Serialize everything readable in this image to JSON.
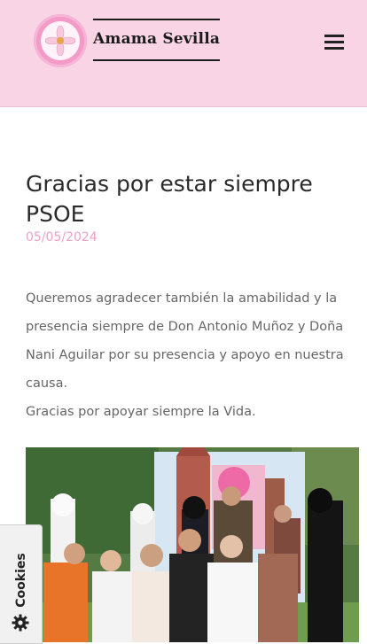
{
  "header": {
    "brand": "Amama Sevilla",
    "logo_icon": "amama-sevilla-logo",
    "menu_icon": "hamburger-menu-icon"
  },
  "post": {
    "title": "Gracias por estar siempre PSOE",
    "date": "05/05/2024",
    "paragraphs": [
      "Queremos agradecer también la amabilidad y la presencia siempre de Don Antonio Muñoz y Doña Nani Aguilar por su presencia y apoyo en nuestra causa.",
      "Gracias por apoyar siempre la Vida."
    ]
  },
  "cookies": {
    "label": "Cookies",
    "icon": "gear-icon"
  },
  "colors": {
    "header_bg": "#f8d4e4",
    "date": "#e8a3c8",
    "body_text": "#666666"
  }
}
